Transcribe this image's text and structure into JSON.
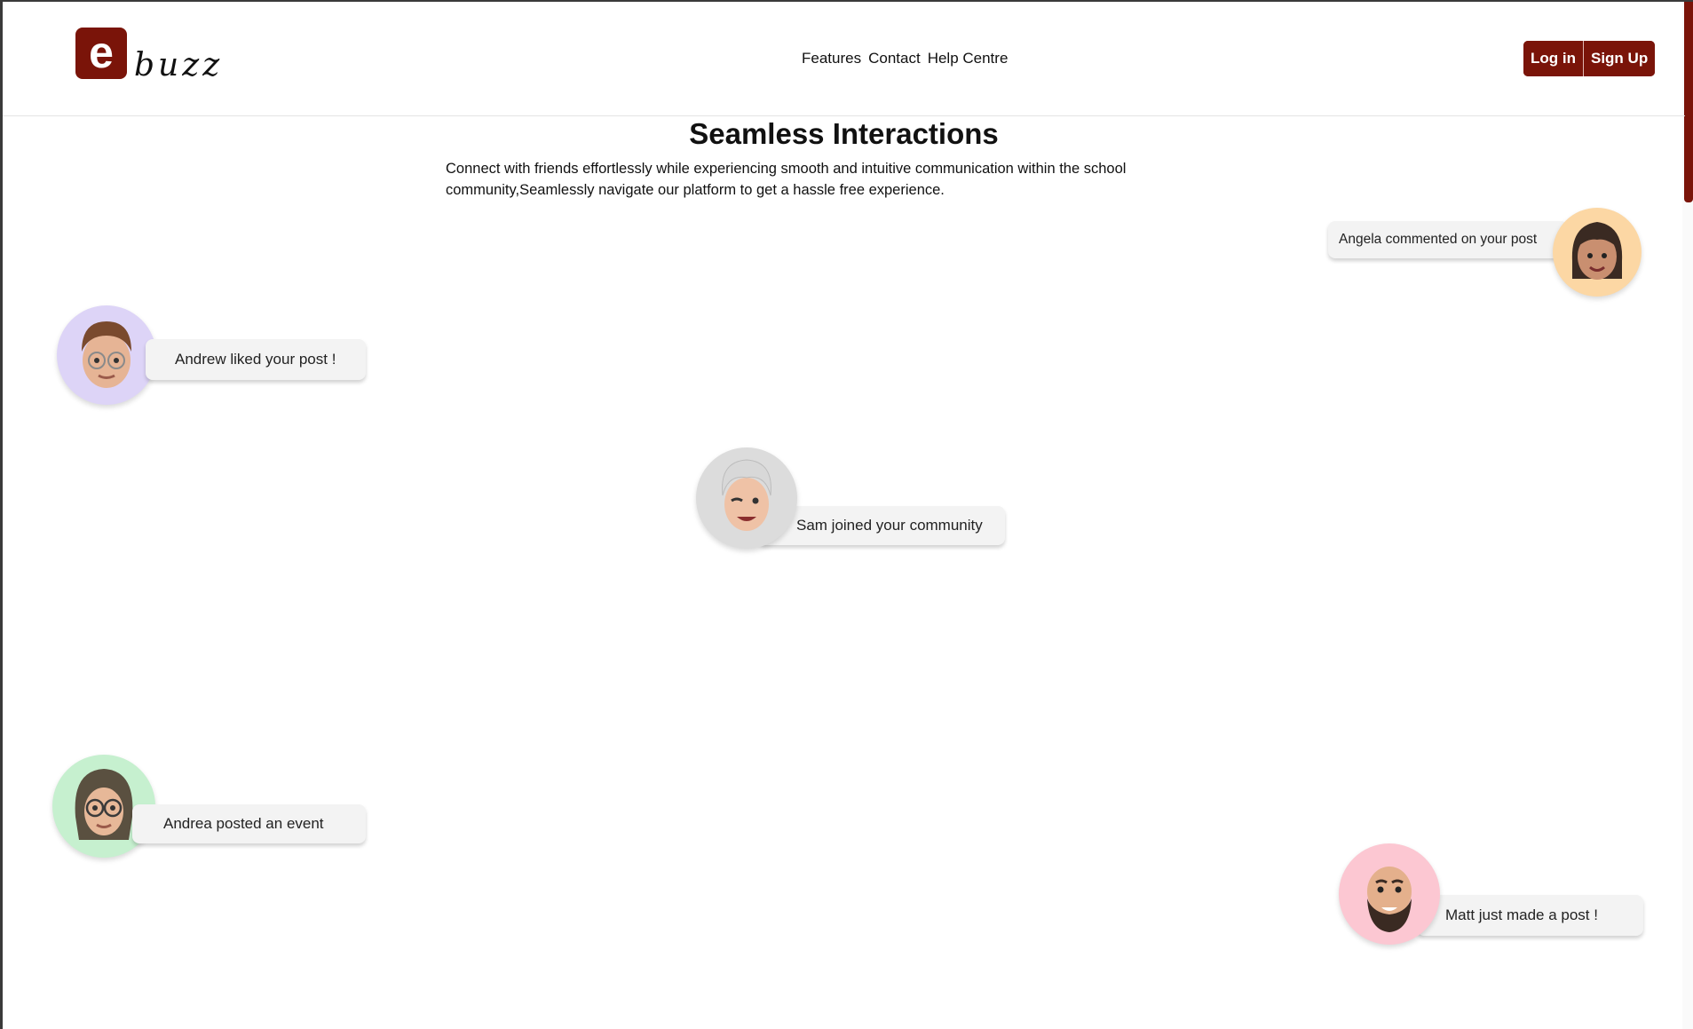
{
  "brand": {
    "logo_letter": "e",
    "logo_word": "buzz",
    "accent_color": "#7a1409"
  },
  "nav": {
    "items": [
      "Features",
      "Contact",
      "Help Centre"
    ]
  },
  "auth": {
    "login_label": "Log in",
    "signup_label": "Sign Up"
  },
  "hero": {
    "title": "Seamless Interactions",
    "description": "Connect with friends effortlessly while experiencing smooth and intuitive communication within the school community,Seamlessly navigate our platform to get a hassle free experience."
  },
  "notifications": [
    {
      "name": "Angela",
      "text": "Angela commented on your post",
      "avatar_color": "#fcd7a4"
    },
    {
      "name": "Andrew",
      "text": "Andrew liked your post !",
      "avatar_color": "#ddd4f7"
    },
    {
      "name": "Sam",
      "text": "Sam joined your community",
      "avatar_color": "#dcdcdc"
    },
    {
      "name": "Andrea",
      "text": "Andrea posted an event",
      "avatar_color": "#c6f0cf"
    },
    {
      "name": "Matt",
      "text": "Matt just made a post !",
      "avatar_color": "#fcc7d2"
    }
  ]
}
